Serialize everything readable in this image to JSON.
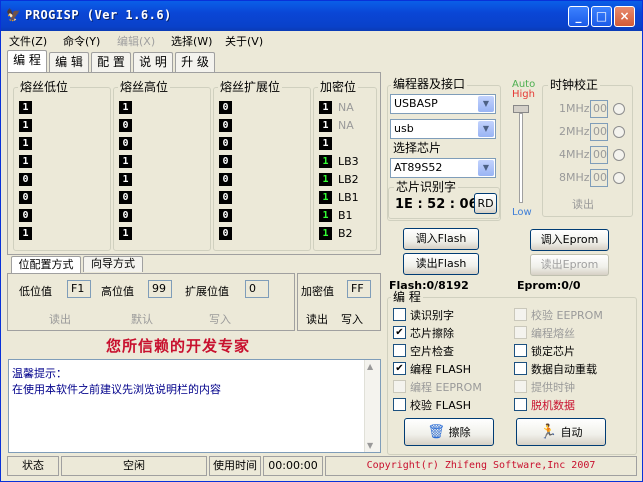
{
  "window": {
    "title": "PROGISP (Ver 1.6.6)",
    "min": "_",
    "max": "□",
    "close": "×"
  },
  "menu": [
    {
      "label": "文件(Z)",
      "disabled": false
    },
    {
      "label": "命令(Y)",
      "disabled": false
    },
    {
      "label": "编辑(X)",
      "disabled": true
    },
    {
      "label": "选择(W)",
      "disabled": false
    },
    {
      "label": "关于(V)",
      "disabled": false
    }
  ],
  "tabs": [
    "编 程",
    "编 辑",
    "配 置",
    "说 明",
    "升 级"
  ],
  "fuse": {
    "low_title": "熔丝低位",
    "high_title": "熔丝高位",
    "ext_title": "熔丝扩展位",
    "lock_title": "加密位",
    "low_bits": [
      "1",
      "1",
      "1",
      "1",
      "0",
      "0",
      "0",
      "1"
    ],
    "high_bits": [
      "1",
      "0",
      "0",
      "1",
      "1",
      "0",
      "0",
      "1"
    ],
    "ext_bits": [
      "0",
      "0",
      "0",
      "0",
      "0",
      "0",
      "0",
      "0"
    ],
    "lock_bits": [
      "1",
      "1",
      "1",
      "1",
      "1",
      "1",
      "1",
      "1"
    ],
    "lock_labels": [
      "NA",
      "NA",
      "",
      "LB3",
      "LB2",
      "LB1",
      "B1",
      "B2"
    ]
  },
  "cfg_tabs": [
    "位配置方式",
    "向导方式"
  ],
  "cfg": {
    "low_label": "低位值",
    "low_value": "F1",
    "high_label": "高位值",
    "high_value": "99",
    "ext_label": "扩展位值",
    "ext_value": "0",
    "lock_label": "加密值",
    "lock_value": "FF",
    "read": "读出",
    "default": "默认",
    "write": "写入",
    "read2": "读出",
    "write2": "写入"
  },
  "slogan": "您所信赖的开发专家",
  "messages": [
    "温馨提示：",
    "在使用本软件之前建议先浏览说明栏的内容"
  ],
  "programmer": {
    "title": "编程器及接口",
    "device": "USBASP",
    "port": "usb",
    "chip_title": "选择芯片",
    "chip": "AT89S52",
    "sig_title": "芯片识别字",
    "sig": "1E : 52 : 06",
    "rd": "RD"
  },
  "clock": {
    "auto": "Auto",
    "high": "High",
    "low": "Low",
    "title": "时钟校正",
    "items": [
      {
        "freq": "1MHz",
        "val": "00"
      },
      {
        "freq": "2MHz",
        "val": "00"
      },
      {
        "freq": "4MHz",
        "val": "00"
      },
      {
        "freq": "8MHz",
        "val": "00"
      }
    ],
    "read": "读出"
  },
  "actions": {
    "load_flash": "调入Flash",
    "read_flash": "读出Flash",
    "load_eprom": "调入Eprom",
    "read_eprom": "读出Eprom",
    "flash_info": "Flash:0/8192",
    "eprom_info": "Eprom:0/0"
  },
  "program": {
    "title": "编 程",
    "options": [
      {
        "label": "读识别字",
        "checked": false,
        "disabled": false
      },
      {
        "label": "校验 EEPROM",
        "checked": false,
        "disabled": true
      },
      {
        "label": "芯片擦除",
        "checked": true,
        "disabled": false
      },
      {
        "label": "编程熔丝",
        "checked": false,
        "disabled": true
      },
      {
        "label": "空片检查",
        "checked": false,
        "disabled": false
      },
      {
        "label": "锁定芯片",
        "checked": false,
        "disabled": false
      },
      {
        "label": "编程 FLASH",
        "checked": true,
        "disabled": false
      },
      {
        "label": "数据自动重载",
        "checked": false,
        "disabled": false
      },
      {
        "label": "编程 EEPROM",
        "checked": false,
        "disabled": true
      },
      {
        "label": "提供时钟",
        "checked": false,
        "disabled": true
      },
      {
        "label": "校验 FLASH",
        "checked": false,
        "disabled": false
      },
      {
        "label": "脱机数据",
        "checked": false,
        "disabled": false
      }
    ],
    "erase": "擦除",
    "auto": "自动"
  },
  "status": {
    "state_label": "状态",
    "state": "空闲",
    "time_label": "使用时间",
    "time": "00:00:00",
    "copyright": "Copyright(r) Zhifeng Software,Inc 2007"
  },
  "colors": {
    "title_blue": "#0a46d6",
    "slogan_red": "#c8102e",
    "copyright_red": "#c8102e",
    "msg_blue": "#00008b"
  }
}
